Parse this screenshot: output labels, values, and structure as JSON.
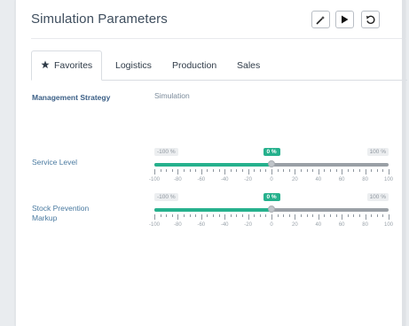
{
  "panel": {
    "title": "Simulation Parameters",
    "toolbar": [
      {
        "name": "magic-wand-button",
        "icon": "magic-wand-icon"
      },
      {
        "name": "run-button",
        "icon": "play-icon"
      },
      {
        "name": "reset-button",
        "icon": "undo-icon"
      }
    ]
  },
  "tabs": [
    {
      "label": "Favorites",
      "icon": "star-icon",
      "active": true
    },
    {
      "label": "Logistics",
      "active": false
    },
    {
      "label": "Production",
      "active": false
    },
    {
      "label": "Sales",
      "active": false
    }
  ],
  "columns": {
    "left": "Management Strategy",
    "right": "Simulation"
  },
  "sliders": [
    {
      "label": "Service Level",
      "min_label": "-100 %",
      "max_label": "100 %",
      "value_label": "0 %",
      "value": 0,
      "min": -100,
      "max": 100,
      "ticks": [
        "-100",
        "-80",
        "-60",
        "-40",
        "-20",
        "0",
        "20",
        "40",
        "60",
        "80",
        "100"
      ]
    },
    {
      "label": "Stock Prevention Markup",
      "min_label": "-100 %",
      "max_label": "100 %",
      "value_label": "0 %",
      "value": 0,
      "min": -100,
      "max": 100,
      "ticks": [
        "-100",
        "-80",
        "-60",
        "-40",
        "-20",
        "0",
        "20",
        "40",
        "60",
        "80",
        "100"
      ]
    }
  ],
  "colors": {
    "accent": "#26b18d",
    "track": "#9aa0a6"
  }
}
